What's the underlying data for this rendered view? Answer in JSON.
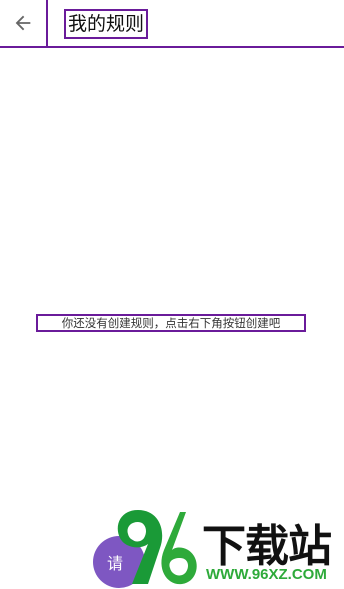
{
  "app_bar": {
    "back_icon": "arrow-back-icon",
    "title": "我的规则"
  },
  "main": {
    "empty_message": "你还没有创建规则，点击右下角按钮创建吧"
  },
  "fab": {
    "label": "请"
  },
  "watermark": {
    "logo_icon": "96-logo",
    "brand": "下载站",
    "url": "WWW.96XZ.COM"
  },
  "colors": {
    "accent_border": "#6a1b9a",
    "fab": "#7e57c2",
    "watermark_green": "#2eaa3a"
  }
}
